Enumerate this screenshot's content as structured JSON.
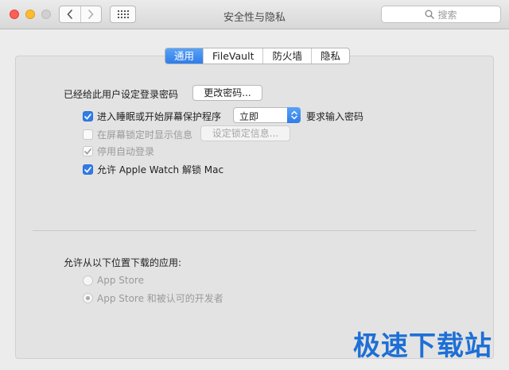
{
  "window": {
    "title": "安全性与隐私",
    "search_placeholder": "搜索",
    "icons": [
      "back-chevron-icon",
      "forward-chevron-icon",
      "grid-icon",
      "search-icon"
    ]
  },
  "tabs": [
    {
      "label": "通用",
      "active": true
    },
    {
      "label": "FileVault",
      "active": false
    },
    {
      "label": "防火墙",
      "active": false
    },
    {
      "label": "隐私",
      "active": false
    }
  ],
  "general": {
    "password_label": "已经给此用户设定登录密码",
    "change_password_button": "更改密码...",
    "require_password": {
      "checked": true,
      "prefix": "进入睡眠或开始屏幕保护程序",
      "delay_value": "立即",
      "suffix": "要求输入密码"
    },
    "show_message": {
      "checked": false,
      "enabled": false,
      "label": "在屏幕锁定时显示信息",
      "button": "设定锁定信息..."
    },
    "disable_auto_login": {
      "checked": true,
      "enabled": false,
      "label": "停用自动登录"
    },
    "apple_watch": {
      "checked": true,
      "enabled": true,
      "label": "允许 Apple Watch 解锁 Mac"
    }
  },
  "downloads": {
    "label": "允许从以下位置下载的应用:",
    "options": [
      {
        "label": "App Store",
        "selected": false,
        "enabled": false
      },
      {
        "label": "App Store 和被认可的开发者",
        "selected": true,
        "enabled": false
      }
    ]
  },
  "watermark": "极速下载站",
  "colors": {
    "accent": "#2f7ce9",
    "watermark": "#1d6fd6"
  }
}
